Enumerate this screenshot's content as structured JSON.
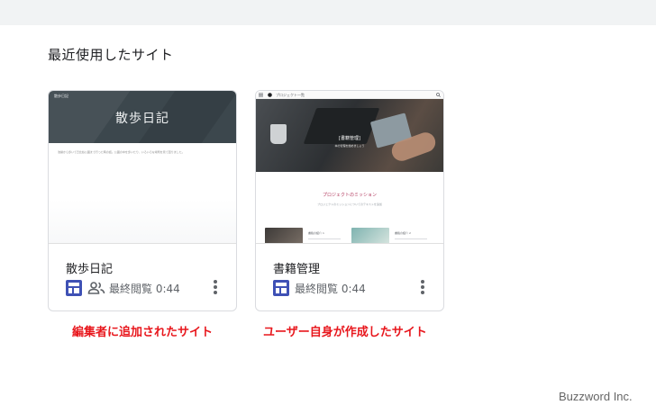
{
  "section_title": "最近使用したサイト",
  "cards": [
    {
      "thumbnail": {
        "site_name": "散歩日記",
        "title": "散歩日記",
        "body_text": "池袋から歩いて日比谷公園まで行った時の話。公園の中を歩いたり、いろいろな場所を見て回りました。"
      },
      "name": "散歩日記",
      "last_viewed": "最終閲覧 0:44",
      "icons": [
        "google-sites-icon",
        "shared-people-icon",
        "more-vert-icon"
      ]
    },
    {
      "thumbnail": {
        "site_name": "プロジェクト一覧",
        "hero_title": "[書籍管理]",
        "hero_sub": "本の管理を始めましょう",
        "heading": "プロジェクトのミッション",
        "text": "プロジェクトのミッションについてのテキストを追加",
        "article_a": "書籍の紹介 1",
        "article_b": "書籍の紹介 2"
      },
      "name": "書籍管理",
      "last_viewed": "最終閲覧 0:44",
      "icons": [
        "google-sites-icon",
        "more-vert-icon"
      ]
    }
  ],
  "captions": [
    "編集者に追加されたサイト",
    "ユーザー自身が作成したサイト"
  ],
  "watermark": "Buzzword Inc.",
  "colors": {
    "site_icon": "#3f51b5",
    "caption": "#e8171d",
    "header_dark": "#3c474d",
    "accent_heading": "#b0345a"
  }
}
